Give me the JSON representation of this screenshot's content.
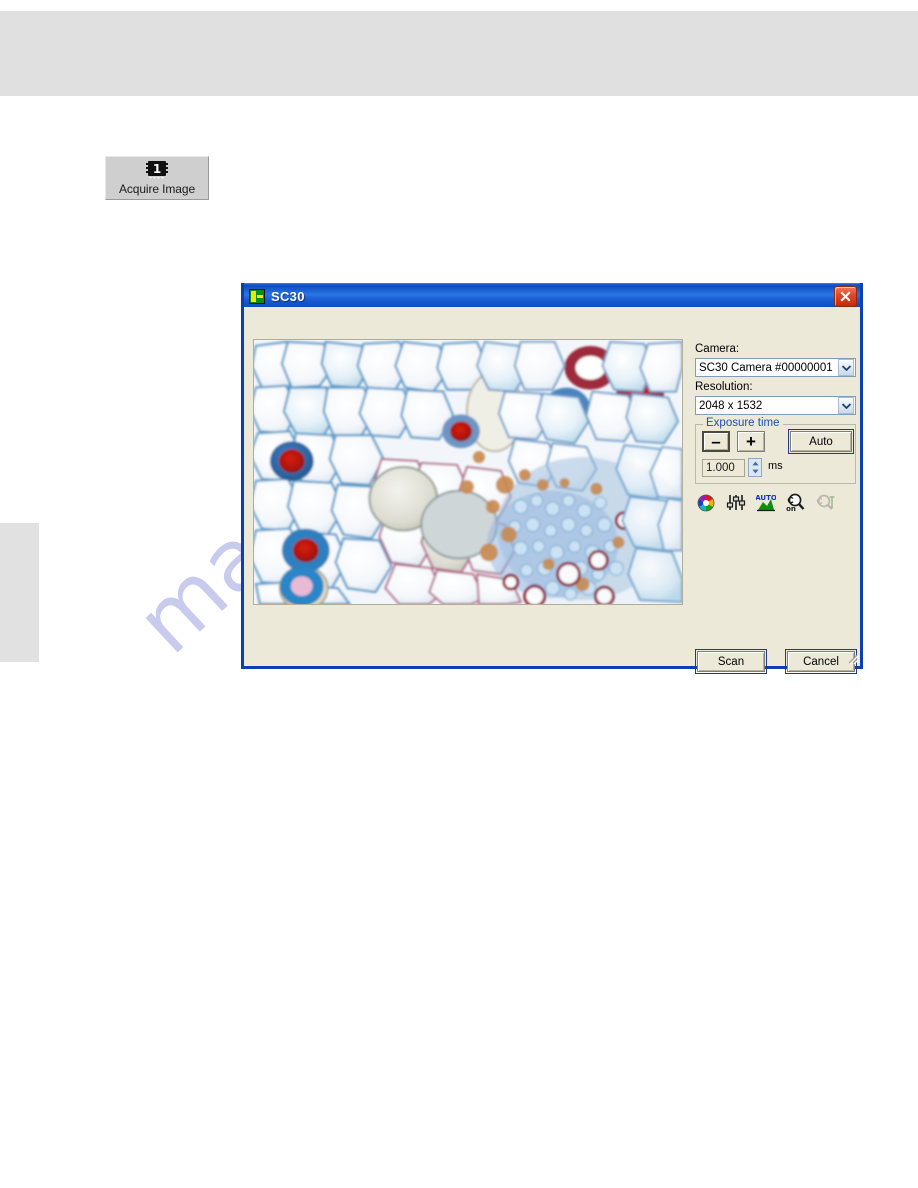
{
  "page": {
    "watermark_text": "manualslib",
    "watermark_color": "#b9bde8",
    "header_band_color": "#e0e0e0",
    "side_tab_color": "#e1e1e1"
  },
  "toolbar": {
    "acquire_button_label": "Acquire Image",
    "acquire_button_icon": "camera-chip-icon",
    "acquire_button_icon_text": "1"
  },
  "dialog": {
    "title": "SC30",
    "title_icon": "sc30-app-icon",
    "titlebar_color": "#1b5ed6",
    "face_color": "#ece9d8",
    "border_color": "#0a3fb5",
    "close_icon": "close-icon",
    "preview": {
      "alt": "plant-stem-cross-section-micrograph"
    },
    "camera": {
      "label": "Camera:",
      "value": "SC30 Camera #00000001",
      "arrow_icon": "chevron-down-icon"
    },
    "resolution": {
      "label": "Resolution:",
      "value": "2048 x 1532",
      "arrow_icon": "chevron-down-icon"
    },
    "exposure": {
      "group_label": "Exposure time",
      "group_label_color": "#1b50b0",
      "minus_label": "–",
      "plus_label": "+",
      "auto_label": "Auto",
      "value": "1.000",
      "unit": "ms",
      "spinner_icon": "spinner-up-down-icon"
    },
    "tool_icons": [
      {
        "name": "color-balance-icon"
      },
      {
        "name": "adjust-sliders-icon"
      },
      {
        "name": "auto-histogram-icon"
      },
      {
        "name": "live-focus-on-icon"
      },
      {
        "name": "measure-disabled-icon"
      }
    ],
    "footer": {
      "scan_label": "Scan",
      "cancel_label": "Cancel"
    },
    "resize_grip_icon": "resize-grip-icon"
  }
}
